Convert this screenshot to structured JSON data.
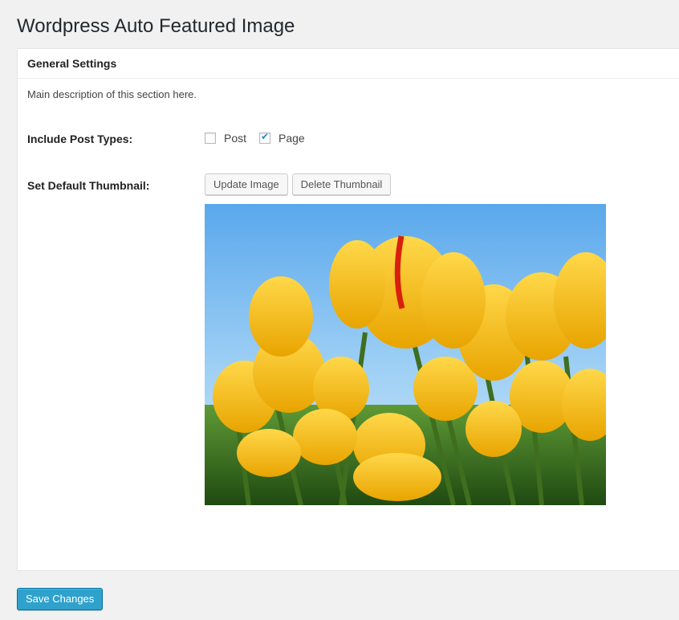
{
  "page": {
    "title": "Wordpress Auto Featured Image"
  },
  "section": {
    "title": "General Settings",
    "description": "Main description of this section here."
  },
  "fields": {
    "post_types": {
      "label": "Include Post Types:",
      "options": [
        {
          "label": "Post",
          "checked": false
        },
        {
          "label": "Page",
          "checked": true
        }
      ]
    },
    "default_thumbnail": {
      "label": "Set Default Thumbnail:",
      "update_button": "Update Image",
      "delete_button": "Delete Thumbnail",
      "image_subject": "yellow-tulips-photo"
    }
  },
  "actions": {
    "save_label": "Save Changes"
  },
  "colors": {
    "primary": "#2ea2cc",
    "background": "#f1f1f1",
    "panel": "#ffffff",
    "tulip_yellow": "#f2b705"
  }
}
